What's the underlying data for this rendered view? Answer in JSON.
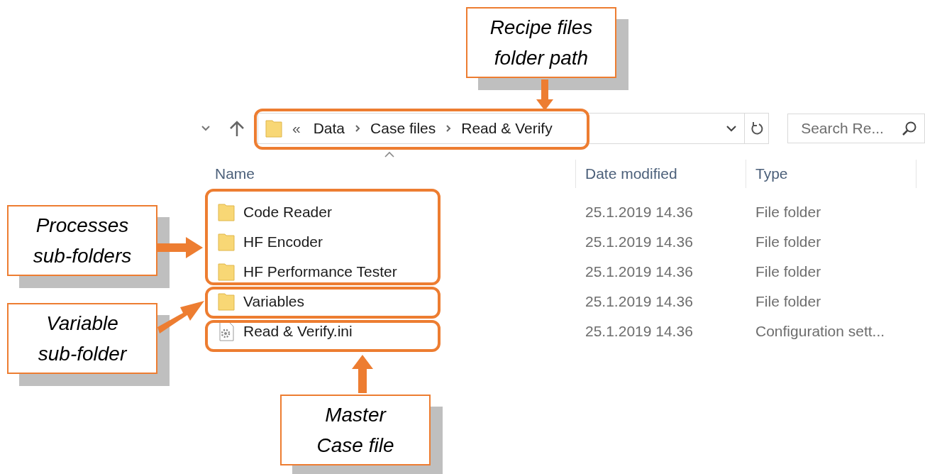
{
  "address_bar": {
    "overflow": "«",
    "path": [
      "Data",
      "Case files",
      "Read & Verify"
    ]
  },
  "search": {
    "placeholder": "Search Re..."
  },
  "columns": [
    "Name",
    "Date modified",
    "Type"
  ],
  "rows": [
    {
      "kind": "folder",
      "name": "Code Reader",
      "date": "25.1.2019 14.36",
      "type": "File folder"
    },
    {
      "kind": "folder",
      "name": "HF Encoder",
      "date": "25.1.2019 14.36",
      "type": "File folder"
    },
    {
      "kind": "folder",
      "name": "HF Performance Tester",
      "date": "25.1.2019 14.36",
      "type": "File folder"
    },
    {
      "kind": "folder",
      "name": "Variables",
      "date": "25.1.2019 14.36",
      "type": "File folder"
    },
    {
      "kind": "settings",
      "name": "Read & Verify.ini",
      "date": "25.1.2019 14.36",
      "type": "Configuration sett..."
    }
  ],
  "callouts": [
    {
      "text": "Recipe files\nfolder path"
    },
    {
      "text": "Processes\nsub-folders"
    },
    {
      "text": "Variable\nsub-folder"
    },
    {
      "text": "Master\nCase file"
    }
  ]
}
